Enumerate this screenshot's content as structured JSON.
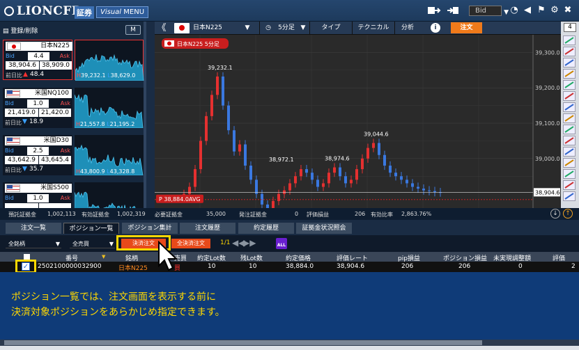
{
  "header": {
    "logo": "LIONCFD",
    "badge": "証券",
    "visual_prefix": "Visual",
    "visual_menu": "MENU",
    "price_type": "Bid"
  },
  "left_panel": {
    "register_label": "登録/削除",
    "m_label": "M",
    "symbols": [
      {
        "name": "日本N225",
        "flag": "jp",
        "bid_label": "Bid",
        "ask_label": "Ask",
        "spread": "4.4",
        "bid": "38,904.6",
        "ask": "38,909.0",
        "change_label": "前日比",
        "change": "48.4",
        "direction": "up",
        "high": "39,232.1",
        "low": "38,629.0",
        "selected": true
      },
      {
        "name": "米国NQ100",
        "flag": "us",
        "bid_label": "Bid",
        "ask_label": "Ask",
        "spread": "1.0",
        "bid": "21,419.0",
        "ask": "21,420.0",
        "change_label": "前日比",
        "change": "18.9",
        "direction": "down",
        "high": "21,557.8",
        "low": "21,195.2",
        "selected": false
      },
      {
        "name": "米国D30",
        "flag": "us",
        "bid_label": "Bid",
        "ask_label": "Ask",
        "spread": "2.5",
        "bid": "43,642.9",
        "ask": "43,645.4",
        "change_label": "前日比",
        "change": "35.7",
        "direction": "down",
        "high": "43,800.9",
        "low": "43,328.8",
        "selected": false
      },
      {
        "name": "米国S500",
        "flag": "us",
        "bid_label": "Bid",
        "ask_label": "Ask",
        "spread": "1.0",
        "bid": "",
        "ask": "",
        "change_label": "",
        "change": "",
        "direction": "",
        "high": "",
        "low": "",
        "selected": false
      }
    ]
  },
  "chart_toolbar": {
    "symbol": "日本N225",
    "period": "5分足",
    "type": "タイプ",
    "technical": "テクニカル",
    "analysis": "分析",
    "info": "i",
    "order": "注文",
    "panel_count": "4"
  },
  "chart_data": {
    "type": "candlestick",
    "title": "日本N225 5分足",
    "y_ticks": [
      "39,300.0",
      "39,200.0",
      "39,100.0",
      "39,000.0"
    ],
    "current_price": "38,904.6",
    "avg_price_label": "38,884.0AVG",
    "avg_marker": "P",
    "annotations": [
      "39,232.1",
      "38,972.1",
      "38,974.6",
      "39,044.6"
    ],
    "ylim": [
      38860,
      39350
    ]
  },
  "summary": {
    "items": [
      {
        "label": "預託証拠金",
        "value": "1,002,113"
      },
      {
        "label": "有効証拠金",
        "value": "1,002,319"
      },
      {
        "label": "必要証拠金",
        "value": "35,000"
      },
      {
        "label": "発注証拠金",
        "value": "0"
      },
      {
        "label": "評価損益",
        "value": "206"
      },
      {
        "label": "有効比率",
        "value": "2,863.76%"
      }
    ]
  },
  "tabs": [
    "注文一覧",
    "ポジション一覧",
    "ポジション集計",
    "注文履歴",
    "約定履歴",
    "証拠金状況照会"
  ],
  "active_tab": 1,
  "controls": {
    "filter_symbol": "全銘柄",
    "filter_side": "全売買",
    "close_order": "決済注文",
    "close_all": "全決済注文",
    "page": "1/1",
    "all_icon": "ALL"
  },
  "table": {
    "columns": [
      "番号",
      "銘柄",
      "売買",
      "約定Lot数",
      "残Lot数",
      "約定価格",
      "評価レート",
      "pip損益",
      "ポジション損益",
      "未実現調整額",
      "評価"
    ],
    "rows": [
      {
        "checked": true,
        "id": "2502100000032900",
        "symbol": "日本N225",
        "side": "買",
        "lots": "10",
        "remaining": "10",
        "price": "38,884.0",
        "rate": "38,904.6",
        "pip": "206",
        "pnl": "206",
        "unrealized": "0",
        "eval": "2"
      }
    ]
  },
  "message": {
    "line1": "ポジション一覧では、注文画面を表示する前に",
    "line2": "決済対象ポジションをあらかじめ指定できます。"
  }
}
